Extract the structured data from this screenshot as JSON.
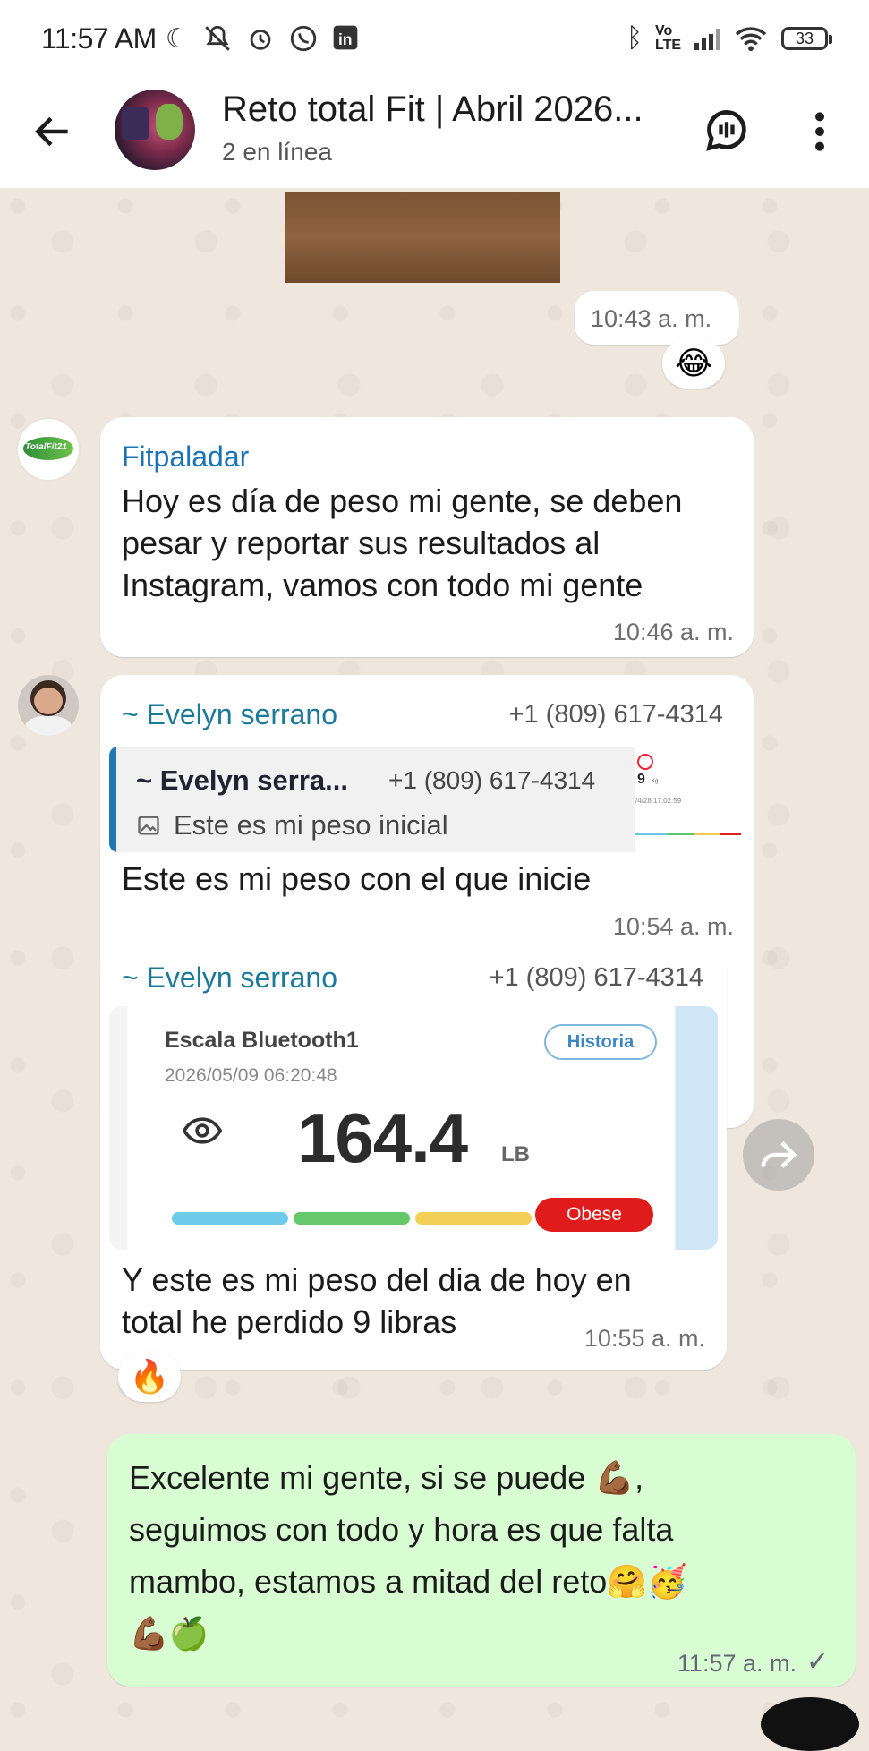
{
  "status_bar": {
    "time": "11:57 AM",
    "battery": "33",
    "network": "Vo LTE"
  },
  "header": {
    "title": "Reto total Fit | Abril 2026...",
    "subtitle": "2 en línea"
  },
  "messages": {
    "m1": {
      "time": "10:43 a. m.",
      "reaction": "😂"
    },
    "m2": {
      "sender": "Fitpaladar",
      "avatar_text": "TotalFit21",
      "text": "Hoy es día de peso mi gente, se deben\npesar y reportar sus resultados al\nInstagram, vamos con todo mi gente",
      "time": "10:46 a. m."
    },
    "m3": {
      "sender": "~ Evelyn serrano",
      "phone": "+1 (809) 617-4314",
      "quote_sender": "~ Evelyn serra...",
      "quote_phone": "+1 (809) 617-4314",
      "quote_text": "Este es mi peso inicial",
      "quote_thumb_value": "9",
      "quote_thumb_unit": "Kg",
      "quote_thumb_date": "/4/28 17:02:59",
      "text": "Este es mi peso con el que inicie",
      "time": "10:54 a. m."
    },
    "m4": {
      "sender": "~ Evelyn serrano",
      "phone": "+1 (809) 617-4314",
      "scale_title": "Escala Bluetooth1",
      "scale_date": "2026/05/09 06:20:48",
      "scale_button": "Historia",
      "weight": "164.4",
      "unit": "LB",
      "status": "Obese",
      "status_color": "#e01b1b",
      "text": "Y este es mi peso del dia de hoy  en\ntotal he perdido 9 libras",
      "time": "10:55 a. m.",
      "reaction": "🔥"
    },
    "m5": {
      "text_line1": "Excelente mi gente, si se puede 💪🏾,",
      "text_line2": "seguimos con todo y hora es que falta",
      "text_line3": "mambo, estamos a mitad del reto🤗🥳",
      "text_line4": "💪🏾🍏",
      "time": "11:57 a. m.",
      "check": "✓"
    }
  }
}
